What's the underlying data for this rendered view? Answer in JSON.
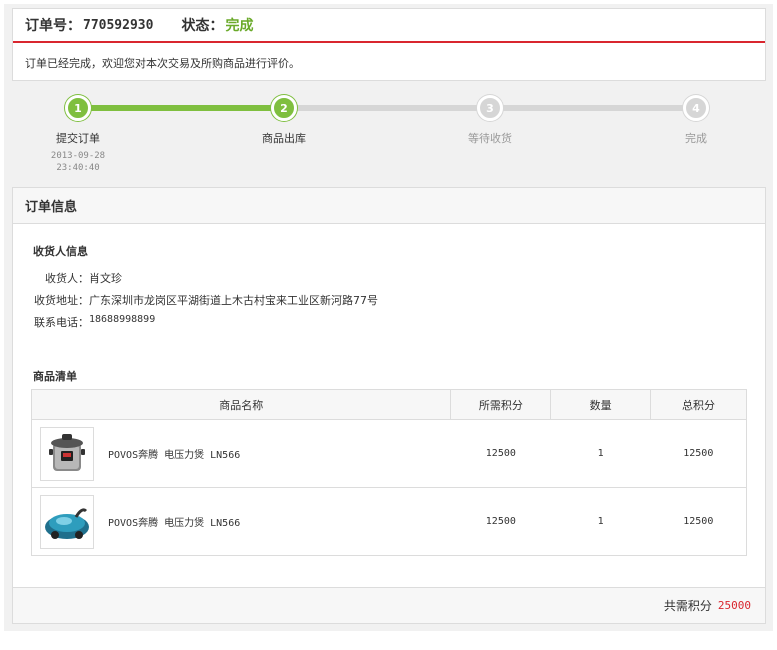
{
  "order": {
    "number_label": "订单号：",
    "number": "770592930",
    "status_label": "状态：",
    "status": "完成",
    "message": "订单已经完成，欢迎您对本次交易及所购商品进行评价。"
  },
  "progress": {
    "steps": [
      {
        "num": "1",
        "label": "提交订单",
        "date": "2013-09-28",
        "time": "23:40:40",
        "state": "done"
      },
      {
        "num": "2",
        "label": "商品出库",
        "state": "done"
      },
      {
        "num": "3",
        "label": "等待收货",
        "state": "pending"
      },
      {
        "num": "4",
        "label": "完成",
        "state": "pending"
      }
    ]
  },
  "info": {
    "panel_title": "订单信息",
    "receiver_section": "收货人信息",
    "receiver_label": "收货人：",
    "receiver": "肖文珍",
    "address_label": "收货地址：",
    "address": "广东深圳市龙岗区平湖街道上木古村宝来工业区新河路77号",
    "phone_label": "联系电话：",
    "phone": "18688998899"
  },
  "goods": {
    "section_title": "商品清单",
    "columns": [
      "商品名称",
      "所需积分",
      "数量",
      "总积分"
    ],
    "rows": [
      {
        "name": "POVOS奔腾 电压力煲 LN566",
        "points": "12500",
        "qty": "1",
        "total": "12500",
        "image": "pressure-cooker-icon"
      },
      {
        "name": "POVOS奔腾 电压力煲 LN566",
        "points": "12500",
        "qty": "1",
        "total": "12500",
        "image": "vacuum-cleaner-icon"
      }
    ]
  },
  "footer": {
    "total_label": "共需积分",
    "total": "25000"
  },
  "colors": {
    "accent_red": "#d9262f",
    "status_green": "#6aaa2a",
    "progress_green": "#7fbf3f"
  }
}
